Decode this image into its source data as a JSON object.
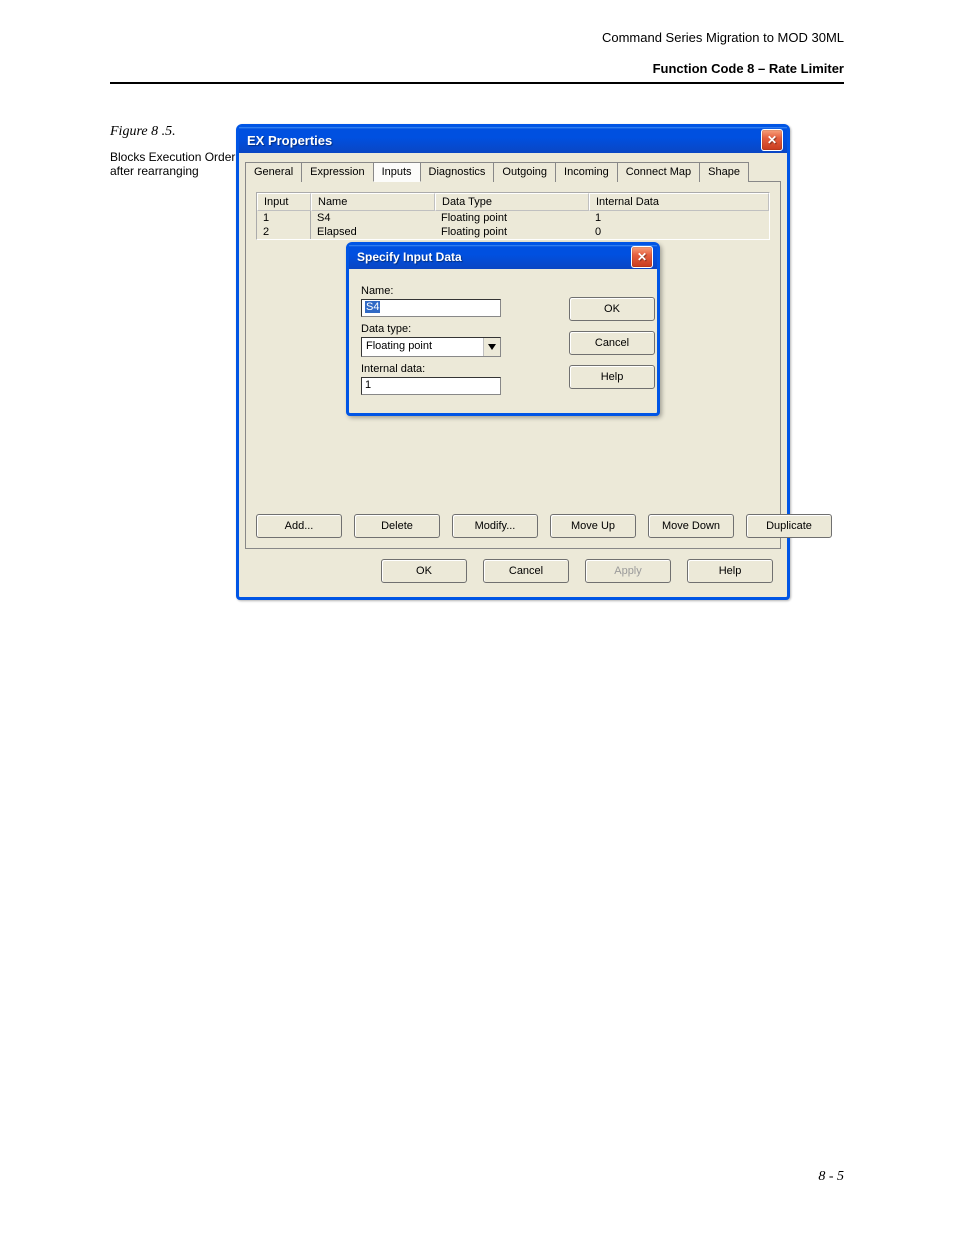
{
  "header": {
    "doc_title": "Command Series Migration to MOD 30ML",
    "section": "Function Code 8 – Rate Limiter"
  },
  "figure": {
    "label": "Figure 8 .5.",
    "caption": "Blocks Execution Order after rearranging"
  },
  "page_number": "8 - 5",
  "window": {
    "title": "EX Properties",
    "tabs": {
      "general": "General",
      "expression": "Expression",
      "inputs": "Inputs",
      "diagnostics": "Diagnostics",
      "outgoing": "Outgoing",
      "incoming": "Incoming",
      "connect_map": "Connect Map",
      "shape": "Shape"
    },
    "table": {
      "headers": {
        "input": "Input",
        "name": "Name",
        "data_type": "Data Type",
        "internal_data": "Internal Data"
      },
      "rows": [
        {
          "idx": "1",
          "name": "S4",
          "data_type": "Floating point",
          "internal": "1"
        },
        {
          "idx": "2",
          "name": "Elapsed",
          "data_type": "Floating point",
          "internal": "0"
        }
      ]
    },
    "panel_buttons": {
      "add": "Add...",
      "delete": "Delete",
      "modify": "Modify...",
      "move_up": "Move Up",
      "move_down": "Move Down",
      "duplicate": "Duplicate"
    },
    "bottom_buttons": {
      "ok": "OK",
      "cancel": "Cancel",
      "apply": "Apply",
      "help": "Help"
    }
  },
  "modal": {
    "title": "Specify Input Data",
    "labels": {
      "name": "Name:",
      "data_type": "Data type:",
      "internal_data": "Internal data:"
    },
    "values": {
      "name": "S4",
      "data_type": "Floating point",
      "internal_data": "1"
    },
    "buttons": {
      "ok": "OK",
      "cancel": "Cancel",
      "help": "Help"
    }
  }
}
